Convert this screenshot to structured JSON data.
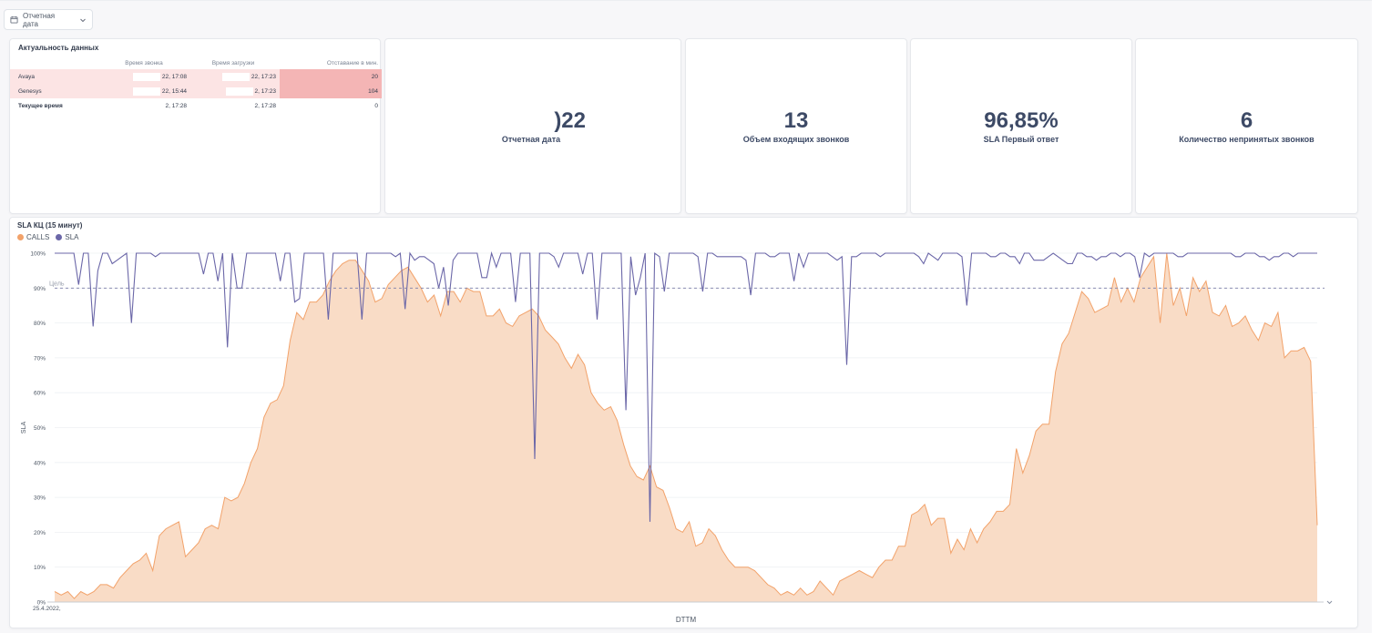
{
  "filter": {
    "label": "Отчетная дата"
  },
  "freshness": {
    "title": "Актуальность данных",
    "columns": [
      "",
      "Время звонка",
      "Время загрузки",
      "Отставание в мин."
    ],
    "rows": [
      {
        "name": "Avaya",
        "call_time": "22, 17:08",
        "load_time": "22, 17:23",
        "lag": "20"
      },
      {
        "name": "Genesys",
        "call_time": "22, 15:44",
        "load_time": "2, 17:23",
        "lag": "104"
      },
      {
        "name": "Текущее время",
        "call_time": "2, 17:28",
        "load_time": "2, 17:28",
        "lag": "0"
      }
    ]
  },
  "kpis": [
    {
      "value": ")22",
      "label": "Отчетная дата"
    },
    {
      "value": "13",
      "label": "Объем входящих звонков"
    },
    {
      "value": "96,85%",
      "label": "SLA Первый ответ"
    },
    {
      "value": "6",
      "label": "Количество непринятых звонков"
    }
  ],
  "chart": {
    "title": "SLA КЦ (15 минут)",
    "legend": [
      {
        "name": "CALLS",
        "color": "#f2a26a"
      },
      {
        "name": "SLA",
        "color": "#6b67a8"
      }
    ],
    "goal_label": "Цель",
    "x_first_label": "25.4.2022,",
    "x_title": "DTTM",
    "y_title": "SLA"
  },
  "chart_data": {
    "type": "area",
    "title": "SLA КЦ (15 минут)",
    "xlabel": "DTTM",
    "ylabel": "SLA",
    "ylim": [
      0,
      100
    ],
    "y_ticks": [
      "0%",
      "10%",
      "20%",
      "30%",
      "40%",
      "50%",
      "60%",
      "70%",
      "80%",
      "90%",
      "100%"
    ],
    "goal": 90,
    "series": [
      {
        "name": "CALLS",
        "color": "#f2a26a",
        "values": [
          3,
          2,
          3,
          1,
          3,
          2,
          3,
          5,
          5,
          4,
          7,
          9,
          11,
          12,
          14,
          9,
          19,
          21,
          22,
          23,
          13,
          15,
          17,
          21,
          22,
          21,
          30,
          29,
          30,
          34,
          40,
          44,
          53,
          57,
          58,
          62,
          75,
          83,
          81,
          86,
          86,
          88,
          92,
          95,
          97,
          98,
          98,
          95,
          92,
          86,
          87,
          91,
          93,
          95,
          96,
          93,
          90,
          86,
          88,
          82,
          89,
          89,
          86,
          90,
          89,
          89,
          82,
          82,
          84,
          80,
          79,
          82,
          83,
          84,
          82,
          78,
          76,
          74,
          70,
          67,
          71,
          68,
          60,
          57,
          55,
          56,
          52,
          45,
          39,
          36,
          35,
          39,
          33,
          32,
          27,
          21,
          20,
          23,
          16,
          17,
          21,
          19,
          15,
          12,
          10,
          10,
          10,
          9,
          7,
          5,
          4,
          2,
          3,
          2,
          4,
          2,
          3,
          6,
          4,
          2,
          6,
          7,
          8,
          9,
          8,
          7,
          10,
          12,
          12,
          16,
          16,
          25,
          26,
          28,
          22,
          24,
          24,
          14,
          18,
          15,
          21,
          17,
          21,
          23,
          26,
          26,
          28,
          44,
          37,
          42,
          49,
          51,
          51,
          66,
          74,
          77,
          83,
          89,
          87,
          83,
          84,
          85,
          93,
          86,
          90,
          86,
          93,
          96,
          99,
          80,
          100,
          85,
          90,
          82,
          93,
          89,
          92,
          83,
          82,
          85,
          79,
          80,
          82,
          78,
          75,
          80,
          79,
          83,
          70,
          72,
          72,
          73,
          69,
          22
        ]
      },
      {
        "name": "SLA",
        "color": "#6b67a8",
        "values": [
          100,
          100,
          100,
          100,
          100,
          91,
          100,
          100,
          79,
          95,
          100,
          100,
          97,
          98,
          99,
          100,
          80,
          100,
          100,
          100,
          100,
          99,
          100,
          100,
          100,
          100,
          100,
          100,
          100,
          100,
          100,
          94,
          100,
          100,
          92,
          100,
          73,
          100,
          90,
          90,
          100,
          100,
          100,
          100,
          100,
          100,
          100,
          92,
          100,
          100,
          86,
          87,
          100,
          100,
          100,
          100,
          100,
          81,
          100,
          100,
          100,
          100,
          100,
          100,
          81,
          100,
          100,
          100,
          100,
          100,
          100,
          99,
          100,
          84,
          100,
          98,
          99,
          99,
          98,
          97,
          90,
          96,
          85,
          98,
          100,
          100,
          100,
          100,
          100,
          93,
          93,
          100,
          96,
          100,
          100,
          100,
          86,
          100,
          100,
          100,
          41,
          100,
          100,
          100,
          99,
          96,
          100,
          100,
          100,
          100,
          94,
          100,
          100,
          81,
          100,
          100,
          100,
          100,
          100,
          55,
          99,
          88,
          93,
          100,
          23,
          100,
          99,
          89,
          100,
          100,
          100,
          100,
          100,
          100,
          99,
          89,
          100,
          100,
          99,
          99,
          99,
          99,
          99,
          99,
          98,
          88,
          100,
          100,
          100,
          99,
          99,
          100,
          100,
          100,
          92,
          100,
          96,
          100,
          100,
          100,
          100,
          100,
          99,
          98,
          99,
          68,
          99,
          99,
          100,
          100,
          100,
          100,
          99,
          100,
          100,
          100,
          100,
          100,
          100,
          100,
          99,
          97,
          100,
          99,
          98,
          100,
          100,
          100,
          100,
          99,
          85,
          100,
          100,
          100,
          100,
          99,
          99,
          100,
          100,
          99,
          99,
          97,
          100,
          100,
          98,
          98,
          98,
          99,
          100,
          99,
          98,
          97,
          97,
          100,
          100,
          99,
          99,
          98,
          99,
          99,
          100,
          100,
          99,
          100,
          100,
          99,
          93,
          100,
          99,
          100,
          100,
          100,
          100,
          100,
          99,
          99,
          100,
          100,
          100,
          100,
          100,
          100,
          100,
          100,
          100,
          100,
          99,
          99,
          100,
          100,
          100,
          99,
          99,
          98,
          99,
          99,
          100,
          100,
          99,
          100,
          100,
          100,
          100,
          100
        ]
      }
    ]
  }
}
